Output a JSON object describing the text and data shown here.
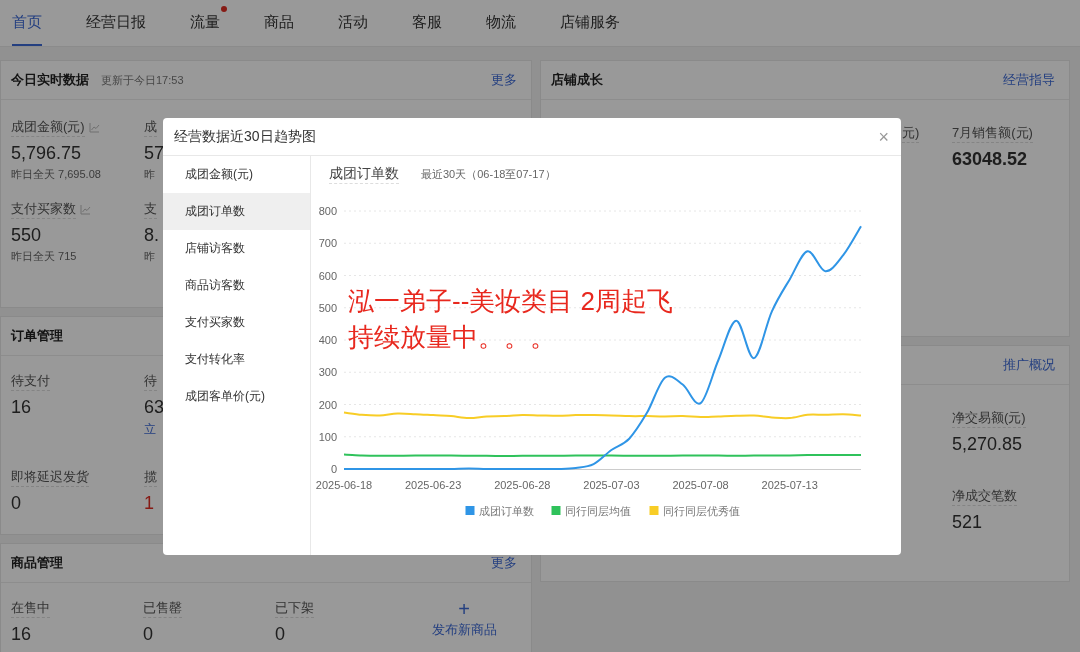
{
  "tabs": [
    {
      "label": "首页",
      "selected": true,
      "dot": false
    },
    {
      "label": "经营日报",
      "selected": false,
      "dot": false
    },
    {
      "label": "流量",
      "selected": false,
      "dot": true
    },
    {
      "label": "商品",
      "selected": false,
      "dot": false
    },
    {
      "label": "活动",
      "selected": false,
      "dot": false
    },
    {
      "label": "客服",
      "selected": false,
      "dot": false
    },
    {
      "label": "物流",
      "selected": false,
      "dot": false
    },
    {
      "label": "店铺服务",
      "selected": false,
      "dot": false
    }
  ],
  "realtime": {
    "title": "今日实时数据",
    "updated": "更新于今日17:53",
    "more": "更多",
    "rows": [
      [
        {
          "label": "成团金额(元)",
          "trend_icon": true,
          "value": "5,796.75",
          "sub": "昨日全天 7,695.08"
        },
        {
          "label": "成",
          "value": "57",
          "sub": "昨"
        }
      ],
      [
        {
          "label": "支付买家数",
          "trend_icon": true,
          "value": "550",
          "sub": "昨日全天 715"
        },
        {
          "label": "支",
          "value": "8.",
          "sub": "昨"
        }
      ]
    ]
  },
  "orders": {
    "title": "订单管理",
    "rows": [
      [
        {
          "label": "待支付",
          "value": "16"
        },
        {
          "label": "待",
          "value": "63",
          "link": "立"
        }
      ],
      [
        {
          "label": "即将延迟发货",
          "value": "0"
        },
        {
          "label": "揽",
          "value": "1",
          "alert": true
        }
      ]
    ]
  },
  "products": {
    "title": "商品管理",
    "more": "更多",
    "metrics": [
      {
        "label": "在售中",
        "value": "16"
      },
      {
        "label": "已售罄",
        "value": "0"
      },
      {
        "label": "已下架",
        "value": "0"
      }
    ],
    "action": {
      "icon": "+",
      "label": "发布新商品"
    }
  },
  "growth": {
    "title": "店铺成长",
    "link": "经营指导",
    "metrics": [
      {
        "label": "元)"
      },
      {
        "label": "7月销售额(元)",
        "value": "63048.52",
        "strong": true
      }
    ]
  },
  "promotion": {
    "link": "推广概况",
    "metrics": [
      {
        "label": "净交易额(元)",
        "value": "5,270.85"
      },
      {
        "label": "净成交笔数",
        "value": "521"
      }
    ]
  },
  "modal": {
    "title": "经营数据近30日趋势图",
    "close": "×",
    "menu": [
      {
        "label": "成团金额(元)",
        "selected": false
      },
      {
        "label": "成团订单数",
        "selected": true
      },
      {
        "label": "店铺访客数",
        "selected": false
      },
      {
        "label": "商品访客数",
        "selected": false
      },
      {
        "label": "支付买家数",
        "selected": false
      },
      {
        "label": "支付转化率",
        "selected": false
      },
      {
        "label": "成团客单价(元)",
        "selected": false
      }
    ],
    "chart_title": "成团订单数",
    "range": "最近30天（06-18至07-17）",
    "chart_data": {
      "type": "line",
      "grid": true,
      "legend": true,
      "xlim": [
        "2025-06-18",
        "2025-07-17"
      ],
      "x": [
        "2025-06-18",
        "2025-06-19",
        "2025-06-20",
        "2025-06-21",
        "2025-06-22",
        "2025-06-23",
        "2025-06-24",
        "2025-06-25",
        "2025-06-26",
        "2025-06-27",
        "2025-06-28",
        "2025-06-29",
        "2025-06-30",
        "2025-07-01",
        "2025-07-02",
        "2025-07-03",
        "2025-07-04",
        "2025-07-05",
        "2025-07-06",
        "2025-07-07",
        "2025-07-08",
        "2025-07-09",
        "2025-07-10",
        "2025-07-11",
        "2025-07-12",
        "2025-07-13",
        "2025-07-14",
        "2025-07-15",
        "2025-07-16",
        "2025-07-17"
      ],
      "xticks": [
        {
          "value": "2025-06-18",
          "label": "2025-06-18"
        },
        {
          "value": "2025-06-23",
          "label": "2025-06-23"
        },
        {
          "value": "2025-06-28",
          "label": "2025-06-28"
        },
        {
          "value": "2025-07-03",
          "label": "2025-07-03"
        },
        {
          "value": "2025-07-08",
          "label": "2025-07-08"
        },
        {
          "value": "2025-07-13",
          "label": "2025-07-13"
        }
      ],
      "ylim": [
        0,
        800
      ],
      "yticks": [
        0,
        100,
        200,
        300,
        400,
        500,
        600,
        700,
        800
      ],
      "series": [
        {
          "name": "成团订单数",
          "color": "#2f95e6",
          "values": [
            0,
            0,
            0,
            0,
            0,
            0,
            0,
            2,
            0,
            0,
            0,
            0,
            0,
            3,
            15,
            59,
            94,
            175,
            283,
            262,
            204,
            338,
            460,
            344,
            489,
            588,
            675,
            613,
            663,
            753
          ]
        },
        {
          "name": "同行同层均值",
          "color": "#2fc25b",
          "values": [
            45,
            42,
            41,
            41,
            42,
            42,
            42,
            41,
            41,
            40,
            41,
            41,
            41,
            42,
            42,
            42,
            41,
            41,
            41,
            42,
            42,
            42,
            41,
            42,
            42,
            42,
            43,
            43,
            43,
            43
          ]
        },
        {
          "name": "同行同层优秀值",
          "color": "#f8cd26",
          "values": [
            175,
            168,
            166,
            172,
            170,
            167,
            164,
            158,
            163,
            164,
            167,
            166,
            165,
            167,
            167,
            166,
            164,
            164,
            163,
            164,
            161,
            163,
            165,
            166,
            160,
            158,
            168,
            168,
            170,
            166
          ]
        }
      ]
    }
  },
  "annotation": {
    "lines": [
      "泓一弟子--美妆类目 2周起飞",
      "持续放量中。。。"
    ]
  }
}
